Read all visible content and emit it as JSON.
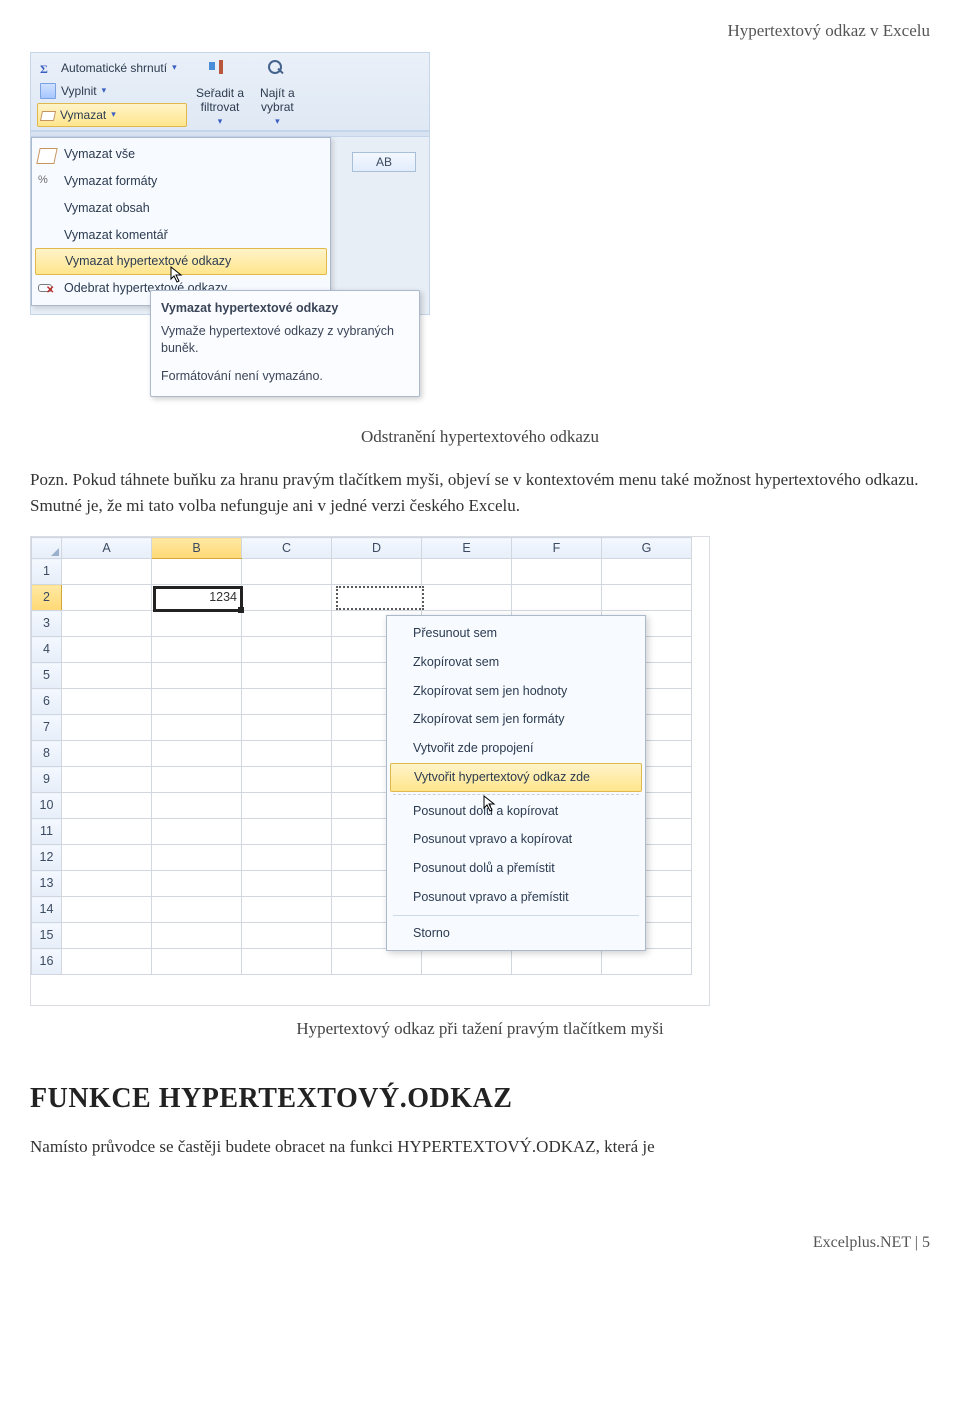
{
  "header": {
    "title": "Hypertextový odkaz v Excelu"
  },
  "shot1": {
    "ribbon": {
      "autosum": "Automatické shrnutí",
      "fill": "Vyplnit",
      "clear": "Vymazat",
      "sort": "Seřadit a\nfiltrovat",
      "find": "Najít a\nvybrat"
    },
    "col_ab": "AB",
    "menu": {
      "all": "Vymazat vše",
      "formats": "Vymazat formáty",
      "contents": "Vymazat obsah",
      "comments": "Vymazat komentář",
      "hyperlinks": "Vymazat hypertextové odkazy",
      "remove_hyperlinks": "Odebrat hypertextové odkazy"
    },
    "tooltip": {
      "title": "Vymazat hypertextové odkazy",
      "body": "Vymaže hypertextové odkazy z vybraných buněk.",
      "foot": "Formátování není vymazáno."
    }
  },
  "caption1": "Odstranění hypertextového odkazu",
  "para1": "Pozn. Pokud táhnete buňku za hranu pravým tlačítkem myši, objeví se v kontextovém menu také možnost hypertextového odkazu. Smutné je, že mi tato volba nefunguje ani v jedné verzi českého Excelu.",
  "shot2": {
    "columns": [
      "A",
      "B",
      "C",
      "D",
      "E",
      "F",
      "G"
    ],
    "rows": [
      "1",
      "2",
      "3",
      "4",
      "5",
      "6",
      "7",
      "8",
      "9",
      "10",
      "11",
      "12",
      "13",
      "14",
      "15",
      "16"
    ],
    "cell_b2": "1234",
    "ctx": {
      "move": "Přesunout sem",
      "copy": "Zkopírovat sem",
      "copy_values": "Zkopírovat sem jen hodnoty",
      "copy_formats": "Zkopírovat sem jen formáty",
      "link_here": "Vytvořit zde propojení",
      "hyperlink_here": "Vytvořit hypertextový odkaz zde",
      "shift_down_copy": "Posunout dolů a kopírovat",
      "shift_right_copy": "Posunout vpravo a kopírovat",
      "shift_down_move": "Posunout dolů a přemístit",
      "shift_right_move": "Posunout vpravo a přemístit",
      "cancel": "Storno"
    }
  },
  "caption2": "Hypertextový odkaz při tažení pravým tlačítkem myši",
  "section_title": "FUNKCE HYPERTEXTOVÝ.ODKAZ",
  "para2": "Namísto průvodce se častěji budete obracet na funkci HYPERTEXTOVÝ.ODKAZ, která je",
  "footer": {
    "text": "Excelplus.NET | 5"
  }
}
